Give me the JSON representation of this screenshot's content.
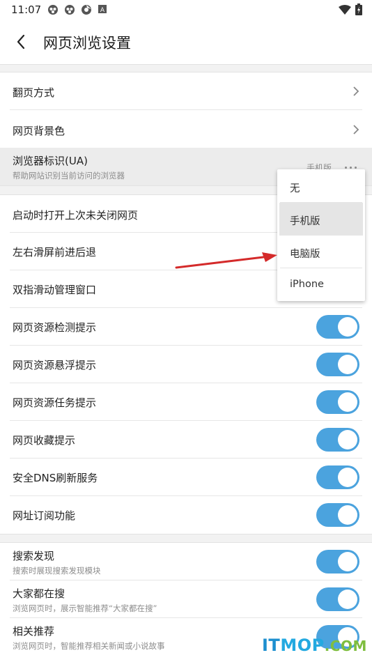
{
  "status_bar": {
    "time": "11:07",
    "icons": [
      "cloud-icon",
      "cloud-icon",
      "aperture-icon",
      "a-box-icon"
    ],
    "right_icons": [
      "wifi-icon",
      "battery-icon"
    ]
  },
  "header": {
    "title": "网页浏览设置"
  },
  "settings": {
    "page_turn": "翻页方式",
    "background": "网页背景色",
    "ua": {
      "label": "浏览器标识(UA)",
      "sub": "帮助网站识别当前访问的浏览器",
      "value": "手机版"
    },
    "restore": "启动时打开上次未关闭网页",
    "swipe": "左右滑屏前进后退",
    "two_finger": "双指滑动管理窗口",
    "toggles": [
      {
        "label": "网页资源检测提示",
        "on": true
      },
      {
        "label": "网页资源悬浮提示",
        "on": true
      },
      {
        "label": "网页资源任务提示",
        "on": true
      },
      {
        "label": "网页收藏提示",
        "on": true
      },
      {
        "label": "安全DNS刷新服务",
        "on": true
      },
      {
        "label": "网址订阅功能",
        "on": true
      }
    ],
    "discover": [
      {
        "label": "搜索发现",
        "sub": "搜索时展现搜索发现模块",
        "on": true
      },
      {
        "label": "大家都在搜",
        "sub": "浏览网页时，展示智能推荐“大家都在搜”",
        "on": true
      },
      {
        "label": "相关推荐",
        "sub": "浏览网页时，智能推荐相关新闻或小说故事",
        "on": true
      }
    ]
  },
  "dropdown": {
    "options": [
      "无",
      "手机版",
      "电脑版",
      "iPhone"
    ],
    "selected": "手机版"
  },
  "colors": {
    "toggle_on": "#4ba3de",
    "annotation_arrow": "#d42a2a"
  },
  "watermark": {
    "part1": "IT",
    "part2": "MOP",
    "part3": ".COM"
  }
}
